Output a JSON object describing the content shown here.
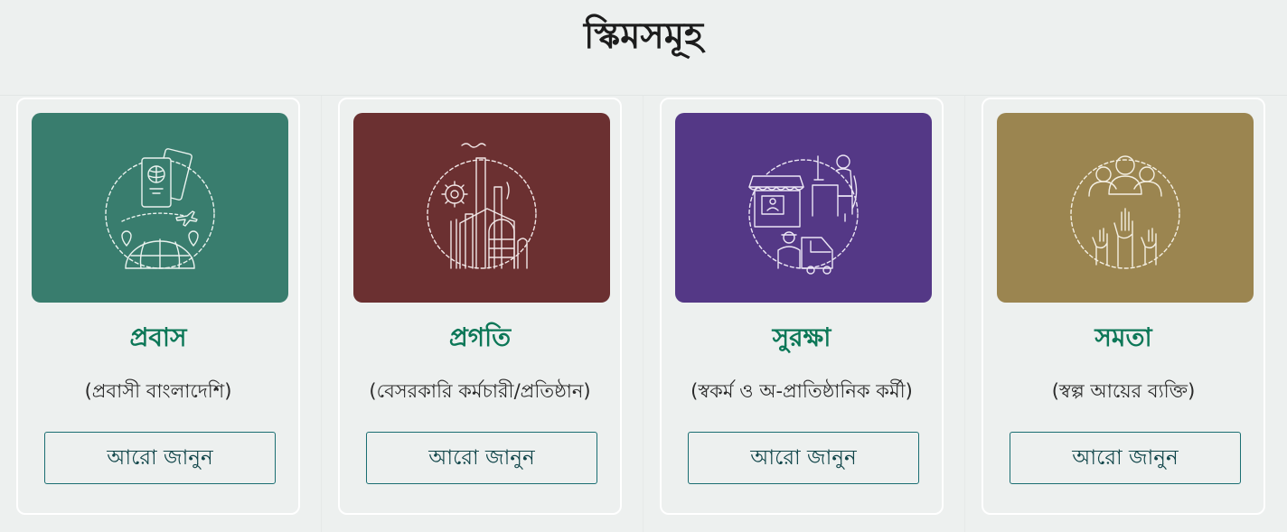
{
  "section": {
    "title": "স্কিমসমূহ"
  },
  "schemes": [
    {
      "title": "প্রবাস",
      "subtitle": "(প্রবাসী বাংলাদেশি)",
      "button_label": "আরো জানুন",
      "color": "#397d6e",
      "icon": "passport-globe-travel-icon"
    },
    {
      "title": "প্রগতি",
      "subtitle": "(বেসরকারি কর্মচারী/প্রতিষ্ঠান)",
      "button_label": "আরো জানুন",
      "color": "#6b3031",
      "icon": "factory-gear-icon"
    },
    {
      "title": "সুরক্ষা",
      "subtitle": "(স্বকর্ম ও অ-প্রাতিষ্ঠানিক কর্মী)",
      "button_label": "আরো জানুন",
      "color": "#543886",
      "icon": "shop-worker-delivery-icon"
    },
    {
      "title": "সমতা",
      "subtitle": "(স্বল্প আয়ের ব্যক্তি)",
      "button_label": "আরো জানুন",
      "color": "#9b8550",
      "icon": "people-raised-hands-icon"
    }
  ]
}
